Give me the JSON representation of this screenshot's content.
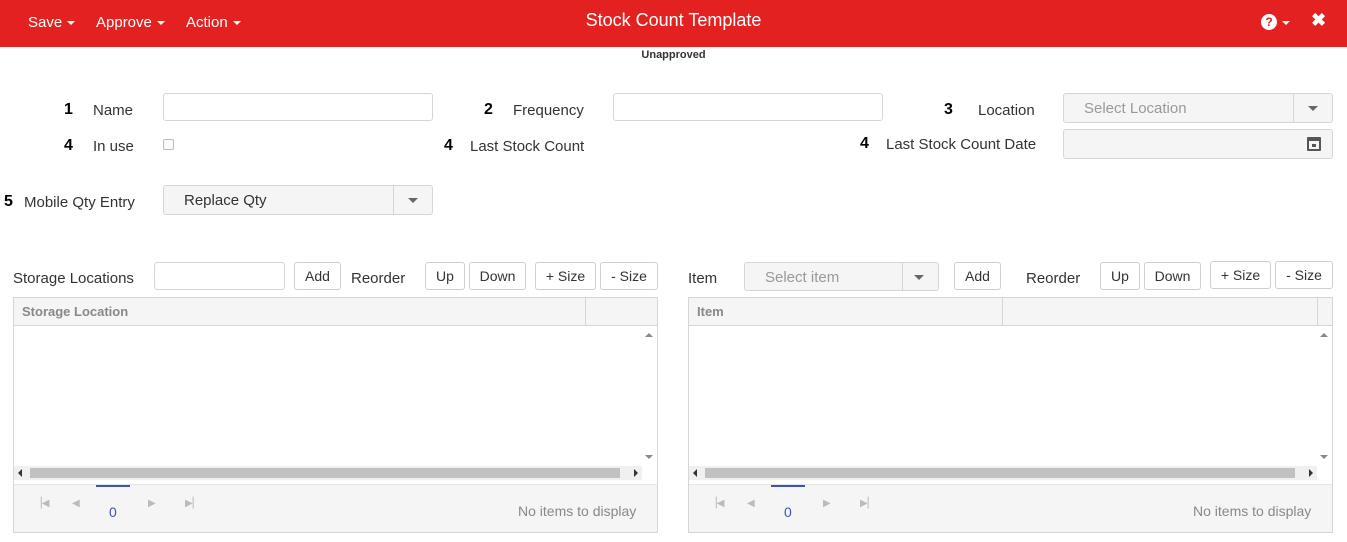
{
  "header": {
    "title": "Stock Count Template",
    "menus": {
      "save": "Save",
      "approve": "Approve",
      "action": "Action"
    },
    "help_glyph": "?",
    "close_glyph": "✖"
  },
  "status": "Unapproved",
  "form": {
    "name": {
      "num": "1",
      "label": "Name",
      "value": ""
    },
    "frequency": {
      "num": "2",
      "label": "Frequency",
      "value": ""
    },
    "location": {
      "num": "3",
      "label": "Location",
      "placeholder": "Select Location"
    },
    "in_use": {
      "num": "4",
      "label": "In use",
      "checked": false
    },
    "last_stock_count": {
      "num": "4",
      "label": "Last Stock Count"
    },
    "last_stock_count_date": {
      "num": "4",
      "label": "Last Stock Count Date",
      "value": ""
    },
    "mobile_qty_entry": {
      "num": "5",
      "label": "Mobile Qty Entry",
      "value": "Replace Qty"
    }
  },
  "storage": {
    "label": "Storage Locations",
    "input_value": "",
    "add": "Add",
    "reorder": "Reorder",
    "up": "Up",
    "down": "Down",
    "plus_size": "+ Size",
    "minus_size": "- Size",
    "grid": {
      "columns": [
        "Storage Location",
        ""
      ],
      "page": "0",
      "empty_message": "No items to display"
    }
  },
  "items": {
    "label": "Item",
    "placeholder": "Select item",
    "add": "Add",
    "reorder": "Reorder",
    "up": "Up",
    "down": "Down",
    "plus_size": "+ Size",
    "minus_size": "- Size",
    "grid": {
      "columns": [
        "Item",
        ""
      ],
      "page": "0",
      "empty_message": "No items to display"
    }
  },
  "colors": {
    "brand": "#e42121",
    "pager_accent": "#3f51b5"
  }
}
